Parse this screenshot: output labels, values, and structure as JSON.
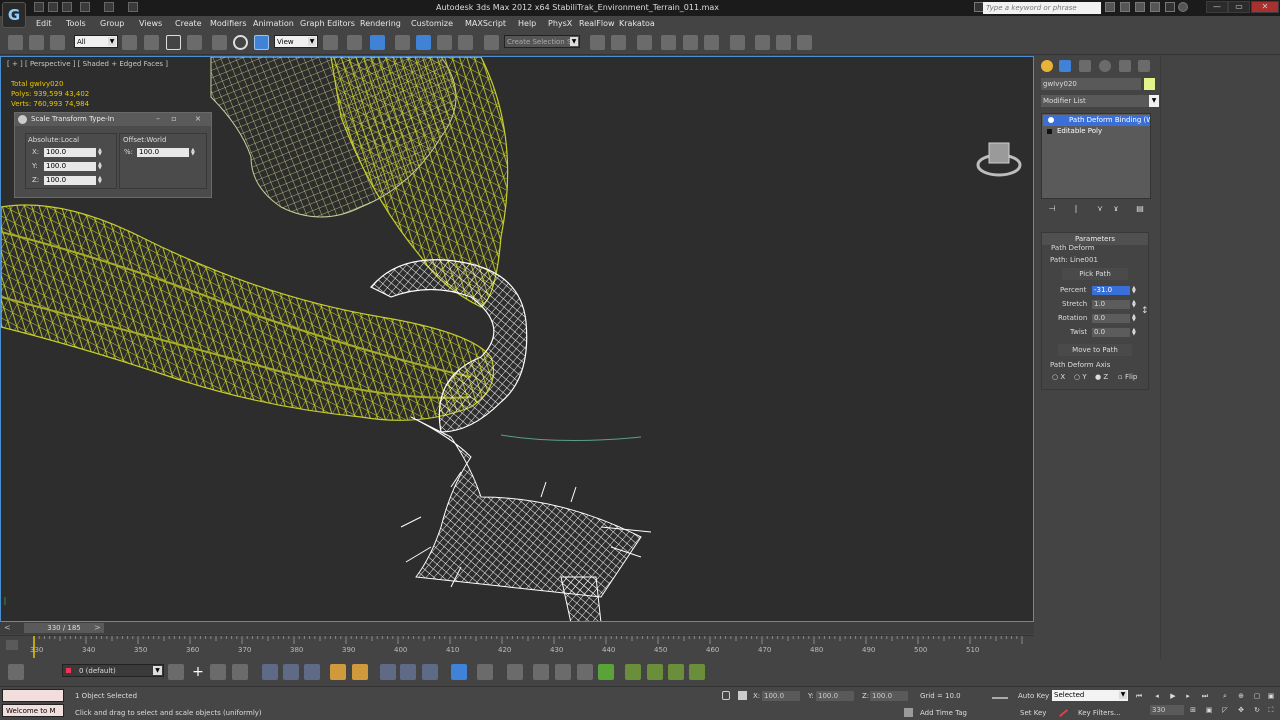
{
  "app": {
    "title": "Autodesk 3ds Max  2012 x64     StabiliTrak_Environment_Terrain_011.max",
    "logo": "G",
    "search_placeholder": "Type a keyword or phrase",
    "win_min": "—",
    "win_max": "▭",
    "win_close": "✕"
  },
  "menu": [
    "Edit",
    "Tools",
    "Group",
    "Views",
    "Create",
    "Modifiers",
    "Animation",
    "Graph Editors",
    "Rendering",
    "Customize",
    "MAXScript",
    "Help",
    "PhysX",
    "RealFlow",
    "Krakatoa"
  ],
  "toolbar": {
    "selection_filter": "All",
    "ref_coord": "View",
    "named_selection": "Create Selection Se"
  },
  "viewport": {
    "label": "[ + ] [ Perspective ] [ Shaded + Edged Faces ]",
    "stats": [
      "Total   gwIvy020",
      "Polys:  939,599  43,402",
      "Verts:  760,993  74,984"
    ],
    "accent_color": "#4b8fd1",
    "wire_green": "#c7cf2b",
    "wire_white": "#ffffff"
  },
  "scale_dialog": {
    "title": "Scale Transform Type-In",
    "absolute_label": "Absolute:Local",
    "offset_label": "Offset:World",
    "x_label": "X:",
    "y_label": "Y:",
    "z_label": "Z:",
    "x_value": "100.0",
    "y_value": "100.0",
    "z_value": "100.0",
    "pct_label": "%:",
    "pct_value": "100.0"
  },
  "command_panel": {
    "object_name": "gwIvy020",
    "object_color": "#e1f58a",
    "modifier_list_label": "Modifier List",
    "stack_items": [
      "Path Deform Binding (WS",
      "Editable Poly"
    ],
    "rollout_title": "Parameters",
    "path_deform_label": "Path Deform",
    "path_label": "Path: Line001",
    "pick_path": "Pick Path",
    "percent_label": "Percent",
    "percent_value": "-31.0",
    "stretch_label": "Stretch",
    "stretch_value": "1.0",
    "rotation_label": "Rotation",
    "rotation_value": "0.0",
    "twist_label": "Twist",
    "twist_value": "0.0",
    "move_to_path": "Move to Path",
    "axis_label": "Path Deform Axis",
    "axis_x": "X",
    "axis_y": "Y",
    "axis_z": "Z",
    "flip": "Flip"
  },
  "timeline": {
    "frame_display": "330 / 185",
    "ticks": [
      "330",
      "340",
      "350",
      "360",
      "370",
      "380",
      "390",
      "400",
      "410",
      "420",
      "430",
      "440",
      "450",
      "460",
      "470",
      "480",
      "490",
      "500",
      "510"
    ]
  },
  "layer": {
    "current": "0 (default)"
  },
  "status": {
    "maxscript": "Welcome to M",
    "selected": "1 Object Selected",
    "prompt": "Click and drag to select and scale objects (uniformly)",
    "x_label": "X:",
    "y_label": "Y:",
    "z_label": "Z:",
    "x_value": "100.0",
    "y_value": "100.0",
    "z_value": "100.0",
    "grid": "Grid = 10.0",
    "add_time_tag": "Add Time Tag",
    "auto_key": "Auto Key",
    "set_key": "Set Key",
    "selected_combo": "Selected",
    "key_filters": "Key Filters...",
    "current_frame": "330"
  }
}
